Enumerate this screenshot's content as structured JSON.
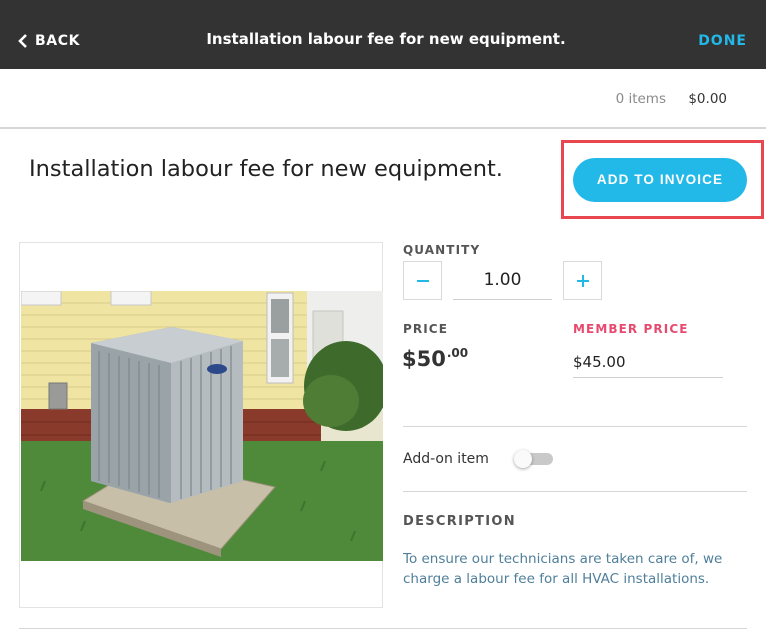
{
  "header": {
    "back_label": "BACK",
    "title": "Installation labour fee for new equipment.",
    "done_label": "DONE"
  },
  "summary": {
    "items_count": "0 items",
    "total": "$0.00"
  },
  "product": {
    "heading": "Installation labour fee for new equipment.",
    "add_button_label": "ADD TO INVOICE",
    "image_description": "air-conditioner-unit-photo",
    "quantity_label": "QUANTITY",
    "quantity_value": "1.00",
    "price_label": "PRICE",
    "price_dollars": "$50",
    "price_cents": ".00",
    "member_price_label": "MEMBER PRICE",
    "member_price_value": "$45.00",
    "addon_label": "Add-on item",
    "addon_enabled": false,
    "description_label": "DESCRIPTION",
    "description_text": "To ensure our technicians are taken care of, we charge a labour fee for all HVAC installations."
  },
  "colors": {
    "accent": "#22b8e8",
    "header_bg": "#333333",
    "member_price": "#e84a6f",
    "highlight_border": "#e8474f"
  }
}
